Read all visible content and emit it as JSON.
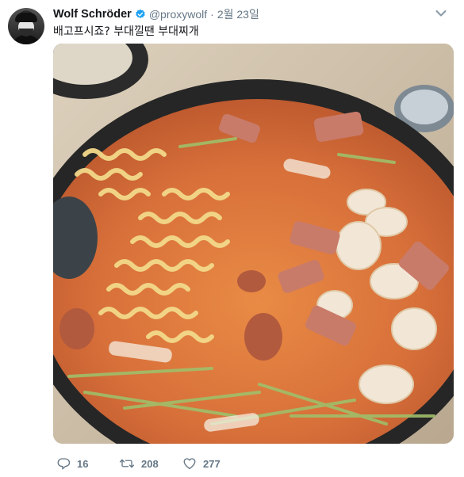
{
  "tweet": {
    "author_name": "Wolf Schröder",
    "handle": "@proxywolf",
    "separator": "·",
    "date": "2월 23일",
    "text": "배고프시죠? 부대낄땐 부대찌개",
    "verified": true
  },
  "actions": {
    "reply_count": "16",
    "retweet_count": "208",
    "like_count": "277"
  },
  "icons": {
    "avatar": "user-avatar",
    "verified": "verified-badge-icon",
    "caret": "chevron-down-icon",
    "reply": "reply-icon",
    "retweet": "retweet-icon",
    "like": "heart-icon"
  },
  "colors": {
    "text": "#14171a",
    "muted": "#657786",
    "verified": "#1da1f2"
  }
}
